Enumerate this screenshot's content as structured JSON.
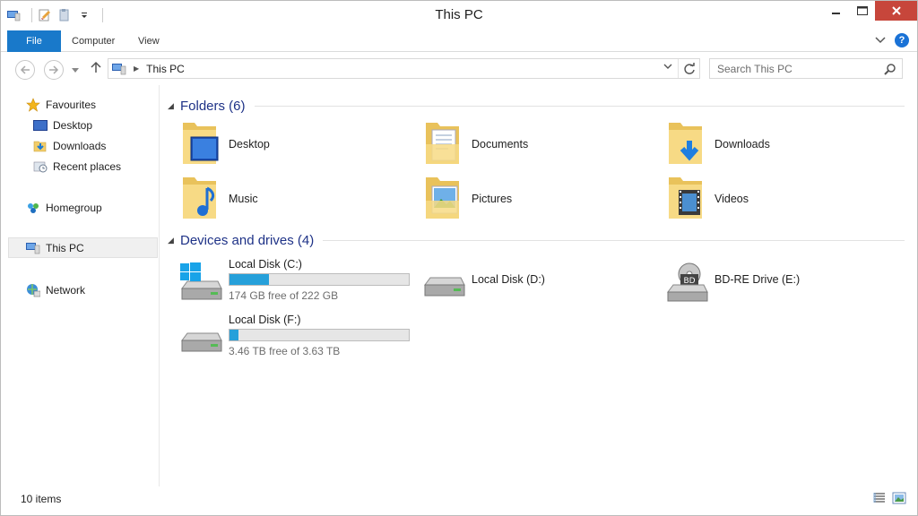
{
  "window": {
    "title": "This PC"
  },
  "ribbon": {
    "tabs": [
      "File",
      "Computer",
      "View"
    ]
  },
  "address": {
    "crumb": "This PC",
    "search_placeholder": "Search This PC"
  },
  "sidebar": {
    "items": [
      {
        "label": "Favourites",
        "icon": "star-icon"
      },
      {
        "label": "Desktop",
        "icon": "desktop-icon"
      },
      {
        "label": "Downloads",
        "icon": "downloads-icon"
      },
      {
        "label": "Recent places",
        "icon": "recent-places-icon"
      },
      {
        "label": "Homegroup",
        "icon": "homegroup-icon"
      },
      {
        "label": "This PC",
        "icon": "this-pc-icon",
        "selected": true
      },
      {
        "label": "Network",
        "icon": "network-icon"
      }
    ]
  },
  "folders": {
    "header": "Folders (6)",
    "items": [
      {
        "label": "Desktop",
        "icon": "desktop-folder-icon"
      },
      {
        "label": "Documents",
        "icon": "documents-folder-icon"
      },
      {
        "label": "Downloads",
        "icon": "downloads-folder-icon"
      },
      {
        "label": "Music",
        "icon": "music-folder-icon"
      },
      {
        "label": "Pictures",
        "icon": "pictures-folder-icon"
      },
      {
        "label": "Videos",
        "icon": "videos-folder-icon"
      }
    ]
  },
  "drives": {
    "header": "Devices and drives (4)",
    "items": [
      {
        "label": "Local Disk (C:)",
        "free": "174 GB free of 222 GB",
        "used_fraction": 0.22,
        "icon": "windows-drive-icon"
      },
      {
        "label": "Local Disk (D:)",
        "icon": "hard-drive-icon"
      },
      {
        "label": "BD-RE Drive (E:)",
        "icon": "bd-drive-icon"
      },
      {
        "label": "Local Disk (F:)",
        "free": "3.46 TB free of 3.63 TB",
        "used_fraction": 0.05,
        "icon": "hard-drive-icon"
      }
    ]
  },
  "status": {
    "count": "10 items"
  },
  "colors": {
    "accent": "#1979ca",
    "group_header": "#1e3287",
    "close": "#c7463b",
    "drive_bar": "#26a0da"
  }
}
